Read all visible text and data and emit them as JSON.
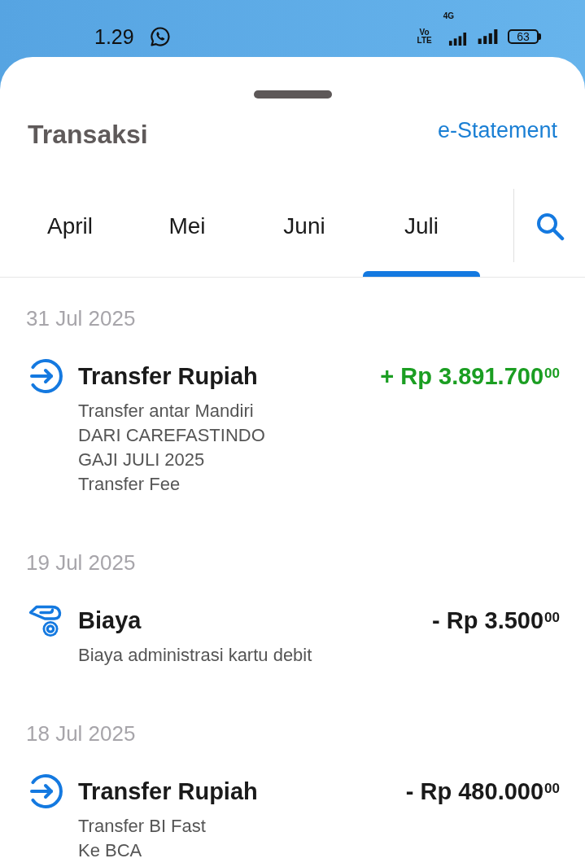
{
  "status_bar": {
    "time": "1.29",
    "volte": "Vo LTE",
    "network_type": "4G",
    "battery": "63"
  },
  "header": {
    "title": "Transaksi",
    "link": "e-Statement"
  },
  "tabs": [
    {
      "label": "April",
      "selected": false
    },
    {
      "label": "Mei",
      "selected": false
    },
    {
      "label": "Juni",
      "selected": false
    },
    {
      "label": "Juli",
      "selected": true
    }
  ],
  "days": [
    {
      "date": "31 Jul 2025",
      "transactions": [
        {
          "kind": "transfer",
          "title": "Transfer Rupiah",
          "amount": "+ Rp 3.891.700$^{00}$",
          "color": "#1b9e22",
          "details": [
            "Transfer antar Mandiri",
            "DARI CAREFASTINDO",
            "GAJI JULI 2025",
            "Transfer Fee"
          ]
        }
      ]
    },
    {
      "date": "19 Jul 2025",
      "transactions": [
        {
          "kind": "fee",
          "title": "Biaya",
          "amount": "- Rp 3.500$^{00}$",
          "color": "#1a1a1a",
          "details": [
            "Biaya administrasi kartu debit"
          ]
        }
      ]
    },
    {
      "date": "18 Jul 2025",
      "transactions": [
        {
          "kind": "transfer",
          "title": "Transfer Rupiah",
          "amount": "- Rp 480.000$^{00}$",
          "color": "#1a1a1a",
          "details": [
            "Transfer BI Fast",
            "Ke BCA"
          ]
        }
      ]
    }
  ]
}
